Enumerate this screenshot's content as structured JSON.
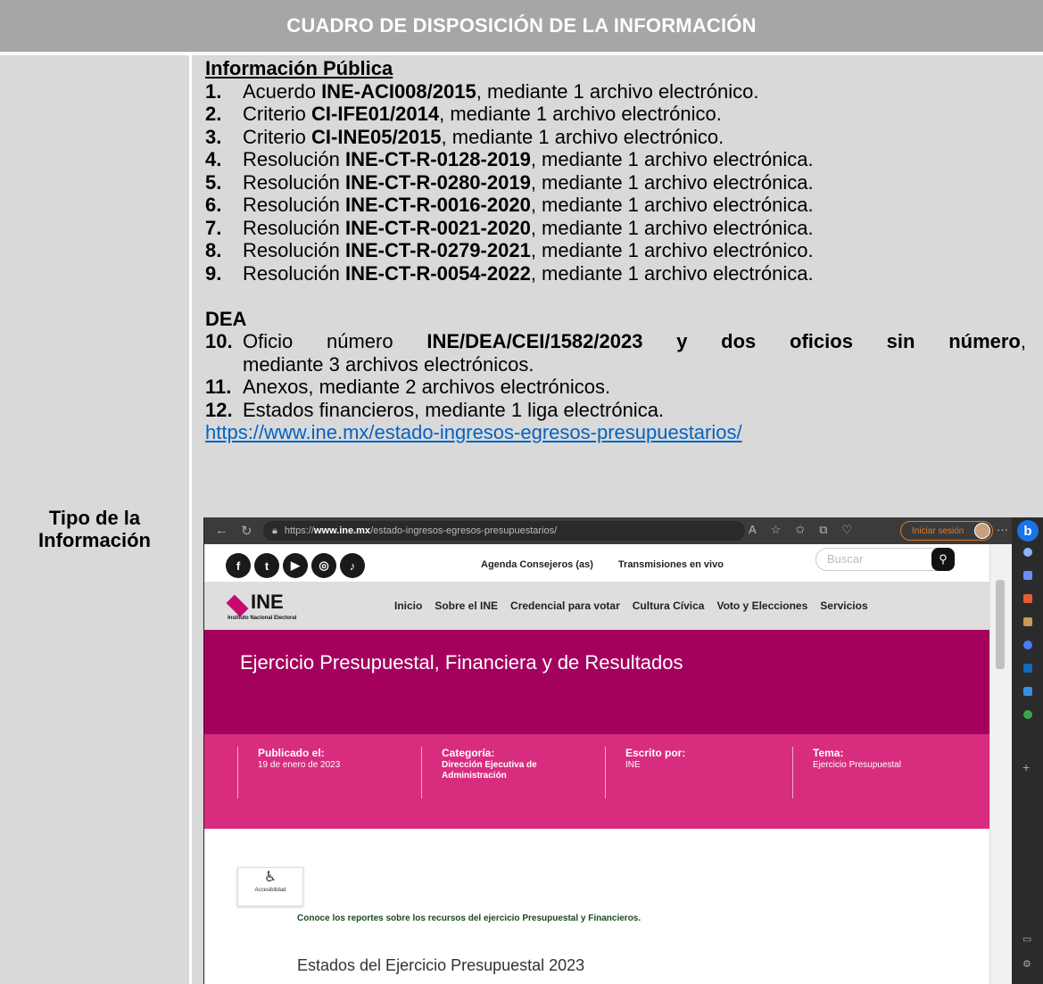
{
  "title": "CUADRO DE DISPOSICIÓN DE LA INFORMACIÓN",
  "left_label": "Tipo de la\nInformación",
  "section1_title": "Información Pública",
  "section1_items": [
    {
      "num": "1.",
      "pre": "Acuerdo ",
      "bold": "INE-ACI008/2015",
      "post": ", mediante 1 archivo electrónico."
    },
    {
      "num": "2.",
      "pre": "Criterio ",
      "bold": "CI-IFE01/2014",
      "post": ", mediante 1 archivo electrónico."
    },
    {
      "num": "3.",
      "pre": "Criterio ",
      "bold": "CI-INE05/2015",
      "post": ", mediante 1 archivo electrónico."
    },
    {
      "num": "4.",
      "pre": "Resolución ",
      "bold": "INE-CT-R-0128-2019",
      "post": ", mediante 1 archivo electrónica."
    },
    {
      "num": "5.",
      "pre": "Resolución ",
      "bold": "INE-CT-R-0280-2019",
      "post": ", mediante 1 archivo electrónica."
    },
    {
      "num": "6.",
      "pre": "Resolución ",
      "bold": "INE-CT-R-0016-2020",
      "post": ", mediante 1 archivo electrónica."
    },
    {
      "num": "7.",
      "pre": "Resolución ",
      "bold": "INE-CT-R-0021-2020",
      "post": ", mediante 1 archivo electrónica."
    },
    {
      "num": "8.",
      "pre": "Resolución ",
      "bold": "INE-CT-R-0279-2021",
      "post": ", mediante 1 archivo electrónico."
    },
    {
      "num": "9.",
      "pre": "Resolución ",
      "bold": "INE-CT-R-0054-2022",
      "post": ", mediante 1 archivo electrónica."
    }
  ],
  "section2_title": "DEA",
  "item10": {
    "num": "10.",
    "pre": "Oficio número ",
    "bold": "INE/DEA/CEI/1582/2023 y dos oficios sin número",
    "comma": ",",
    "line2": "mediante 3 archivos electrónicos."
  },
  "item11": {
    "num": "11.",
    "text": "Anexos, mediante 2 archivos electrónicos."
  },
  "item12": {
    "num": "12.",
    "text": "Estados financieros, mediante 1 liga electrónica."
  },
  "link": "https://www.ine.mx/estado-ingresos-egresos-presupuestarios/",
  "browser": {
    "url_prefix": "https://",
    "url_domain": "www.ine.mx",
    "url_path": "/estado-ingresos-egresos-presupuestarios/",
    "signin": "Iniciar sesión",
    "bing": "b",
    "social": [
      "f",
      "t",
      "▶",
      "◎",
      "♪"
    ],
    "toplinks": [
      "Agenda Consejeros (as)",
      "Transmisiones en vivo"
    ],
    "search_placeholder": "Buscar",
    "logo_text": "INE",
    "logo_sub": "Instituto Nacional Electoral",
    "menu": [
      "Inicio",
      "Sobre el INE",
      "Credencial para votar",
      "Cultura Cívica",
      "Voto y Elecciones",
      "Servicios"
    ],
    "hero_title": "Ejercicio Presupuestal, Financiera y de Resultados",
    "meta": [
      {
        "label": "Publicado el:",
        "value": "19 de enero de 2023"
      },
      {
        "label": "Categoría:",
        "value": "Dirección Ejecutiva de Administración"
      },
      {
        "label": "Escrito por:",
        "value": "INE"
      },
      {
        "label": "Tema:",
        "value": "Ejercicio Presupuestal"
      }
    ],
    "accessibility": "Accesibilidad",
    "intro": "Conoce los reportes sobre los recursos del ejercicio Presupuestal y Financieros.",
    "heading": "Estados del Ejercicio Presupuestal 2023"
  }
}
